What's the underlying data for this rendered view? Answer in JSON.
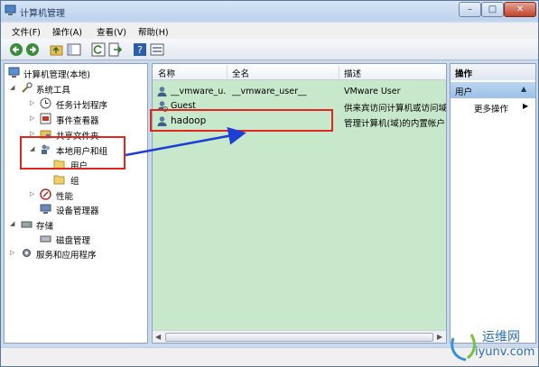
{
  "window": {
    "title": "计算机管理"
  },
  "menu": [
    "文件(F)",
    "操作(A)",
    "查看(V)",
    "帮助(H)"
  ],
  "toolbar_icons": [
    "back-arrow-icon",
    "forward-arrow-icon",
    "up-folder-icon",
    "show-hide-tree-icon",
    "refresh-icon",
    "export-list-icon",
    "help-icon",
    "properties-icon"
  ],
  "tree": {
    "root": "计算机管理(本地)",
    "system_tools": "系统工具",
    "task_scheduler": "任务计划程序",
    "event_viewer": "事件查看器",
    "shared_folders": "共享文件夹",
    "local_users": "本地用户和组",
    "users": "用户",
    "groups": "组",
    "performance": "性能",
    "device_manager": "设备管理器",
    "storage": "存储",
    "disk_management": "磁盘管理",
    "services_apps": "服务和应用程序"
  },
  "list": {
    "columns": [
      "名称",
      "全名",
      "描述"
    ],
    "rows": [
      {
        "name": "__vmware_u...",
        "fullname": "__vmware_user__",
        "desc": "VMware User"
      },
      {
        "name": "Guest",
        "fullname": "",
        "desc": "供来宾访问计算机或访问域"
      },
      {
        "name": "hadoop",
        "fullname": "",
        "desc": "管理计算机(域)的内置帐户"
      }
    ]
  },
  "actions": {
    "header": "操作",
    "section": "用户",
    "more": "更多操作"
  },
  "watermark": {
    "cn": "运维网",
    "en": "iyunv.com"
  },
  "colors": {
    "highlight_red": "#e0261f",
    "arrow_blue": "#1e3fd6",
    "list_bg": "#c8e8cb"
  }
}
